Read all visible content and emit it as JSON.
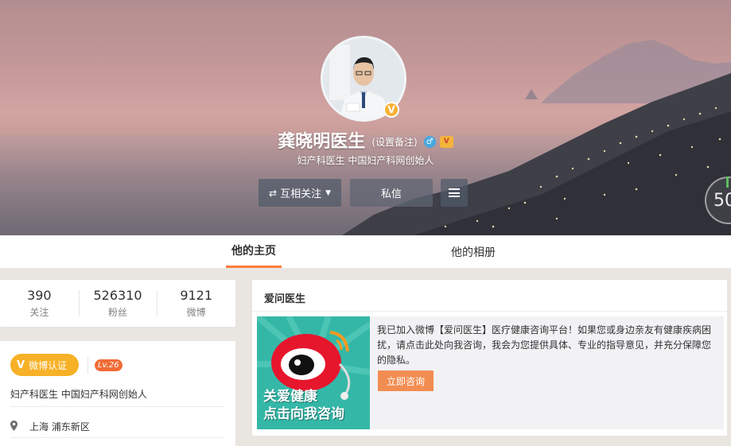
{
  "profile": {
    "name": "龚晓明医生",
    "remark_label": "(设置备注)",
    "gender_symbol": "♂",
    "vip_symbol": "V",
    "verified_symbol": "V",
    "bio": "妇产科医生 中国妇产科网创始人"
  },
  "actions": {
    "follow_label": "互相关注",
    "follow_arrows": "⇄",
    "follow_caret": "▼",
    "message_label": "私信"
  },
  "side_widget": {
    "text": "50"
  },
  "tabs": [
    {
      "label": "他的主页",
      "active": true
    },
    {
      "label": "他的相册",
      "active": false
    }
  ],
  "stats": [
    {
      "value": "390",
      "label": "关注"
    },
    {
      "value": "526310",
      "label": "粉丝"
    },
    {
      "value": "9121",
      "label": "微博"
    }
  ],
  "info": {
    "verify_v": "V",
    "verify_label": "微博认证",
    "level": "Lv.26",
    "bio": "妇产科医生 中国妇产科网创始人",
    "location": "上海 浦东新区"
  },
  "card": {
    "title": "爱问医生",
    "text": "我已加入微博【爱问医生】医疗健康咨询平台！如果您或身边亲友有健康疾病困扰，请点击此处向我咨询，我会为您提供具体、专业的指导意见，并充分保障您的隐私。",
    "button_label": "立即咨询",
    "promo_line1": "关爱健康",
    "promo_line2": "点击向我咨询"
  },
  "colors": {
    "accent": "#fa7d3c",
    "verify_badge": "#f7b127",
    "level_badge": "#f26b36",
    "consult_button": "#f28d52"
  }
}
